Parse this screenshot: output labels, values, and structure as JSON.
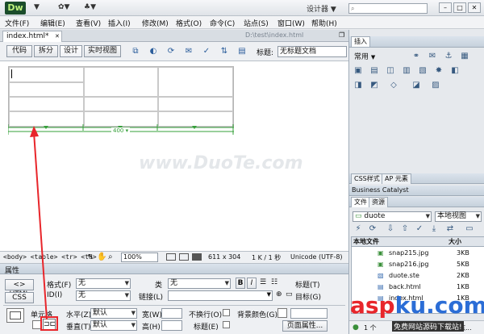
{
  "app": {
    "logo": "Dw",
    "title_menus": [
      "▼",
      "✿▼",
      "♣▼"
    ],
    "workspace": "设计器 ▼",
    "search_icon": "search-icon",
    "window_buttons": [
      "–",
      "□",
      "✕"
    ]
  },
  "menubar": [
    "文件(F)",
    "编辑(E)",
    "查看(V)",
    "插入(I)",
    "修改(M)",
    "格式(O)",
    "命令(C)",
    "站点(S)",
    "窗口(W)",
    "帮助(H)"
  ],
  "document": {
    "tab_label": "index.html*",
    "tab_close": "✕",
    "path": "D:\\test\\index.html"
  },
  "toolbar": {
    "views": [
      "代码",
      "拆分",
      "设计",
      "实时视图"
    ],
    "title_label": "标题:",
    "title_value": "无标题文档"
  },
  "design": {
    "table_width_label": "400 ▾",
    "watermark": "www.DuoTe.com"
  },
  "statusbar": {
    "tags": "<body> <table> <tr> <td>",
    "zoom": "100%",
    "size": "611 x 304",
    "download": "1 K / 1 秒",
    "encoding": "Unicode (UTF-8)"
  },
  "properties": {
    "panel_title": "属性",
    "html_button": "<> HTML",
    "css_button": "CSS",
    "format_label": "格式(F)",
    "format_value": "无",
    "class_label": "类",
    "class_value": "无",
    "id_label": "ID(I)",
    "id_value": "无",
    "link_label": "链接(L)",
    "bold": "B",
    "italic": "I",
    "title_label": "标题(T)",
    "target_label": "目标(G)",
    "cell_label": "单元格",
    "horz_label": "水平(Z)",
    "horz_value": "默认",
    "vert_label": "垂直(T)",
    "vert_value": "默认",
    "width_label": "宽(W)",
    "height_label": "高(H)",
    "nowrap_label": "不换行(O)",
    "header_label": "标题(E)",
    "bgcolor_label": "背景颜色(G)",
    "page_props": "页面属性..."
  },
  "panel": {
    "insert_tab": "插入",
    "category": "常用",
    "css_tab": "CSS样式",
    "ap_tab": "AP 元素",
    "bc_header": "Business Catalyst",
    "files_tab": "文件",
    "assets_tab": "资源",
    "site": "duote",
    "view": "本地视图",
    "col_local": "本地文件",
    "col_size": "大小",
    "files": [
      {
        "name": "snap215.jpg",
        "size": "3KB"
      },
      {
        "name": "snap216.jpg",
        "size": "5KB"
      },
      {
        "name": "duote.ste",
        "size": "2KB"
      },
      {
        "name": "back.html",
        "size": "1KB"
      },
      {
        "name": "index.html",
        "size": "1KB"
      }
    ],
    "footer_count": "1 个",
    "footer_log": "日志..."
  },
  "watermark_brand": {
    "text": "aspku.com",
    "sub": "免费网站源码下载站!"
  },
  "colors": {
    "arrow": "#e8262b",
    "width_bar": "#35a039",
    "brand_red": "#e8262b",
    "brand_blue": "#2b6dd6"
  }
}
